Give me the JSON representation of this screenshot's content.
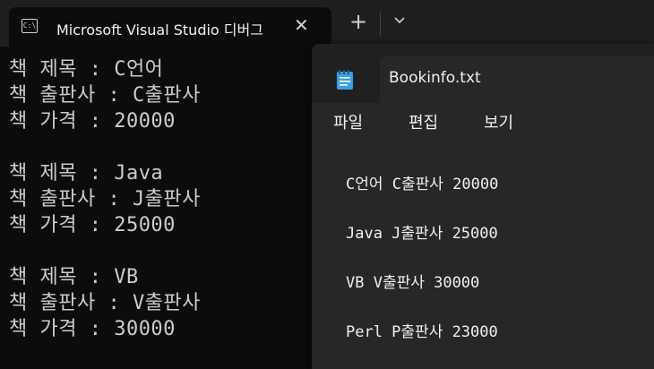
{
  "terminal": {
    "tab_title": "Microsoft Visual Studio 디버그",
    "tab_icon_text": "C:\\",
    "close_glyph": "✕",
    "add_glyph": "+",
    "lines": [
      "책 제목 : C언어",
      "책 출판사 : C출판사",
      "책 가격 : 20000",
      "",
      "책 제목 : Java",
      "책 출판사 : J출판사",
      "책 가격 : 25000",
      "",
      "책 제목 : VB",
      "책 출판사 : V출판사",
      "책 가격 : 30000"
    ]
  },
  "notepad": {
    "filename": "Bookinfo.txt",
    "menu": [
      "파일",
      "편집",
      "보기"
    ],
    "lines": [
      "C언어 C출판사 20000",
      "Java J출판사 25000",
      "VB V출판사 30000",
      "Perl P출판사 23000"
    ]
  },
  "colors": {
    "console_bg": "#0c0c0c",
    "console_text": "#cccccc",
    "notepad_bg": "#272727",
    "notepad_icon": "#3aa0e0"
  }
}
